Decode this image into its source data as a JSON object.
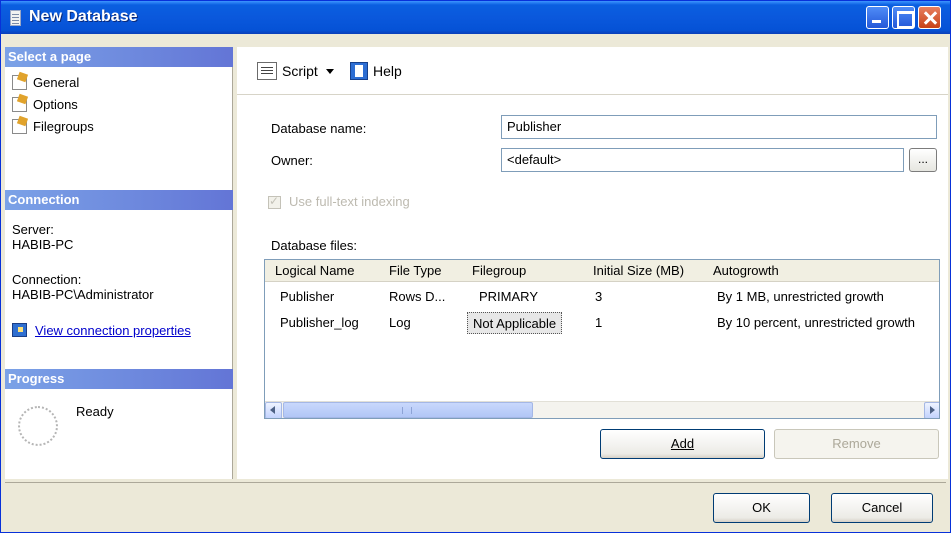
{
  "window": {
    "title": "New Database"
  },
  "left": {
    "select_page_header": "Select a page",
    "pages": [
      "General",
      "Options",
      "Filegroups"
    ],
    "connection_header": "Connection",
    "server_label": "Server:",
    "server_value": "HABIB-PC",
    "connection_label": "Connection:",
    "connection_value": "HABIB-PC\\Administrator",
    "view_connection_link": "View connection properties",
    "progress_header": "Progress",
    "progress_status": "Ready"
  },
  "toolbar": {
    "script_label": "Script",
    "help_label": "Help"
  },
  "form": {
    "db_name_label": "Database name:",
    "db_name_value": "Publisher",
    "owner_label": "Owner:",
    "owner_value": "<default>",
    "browse_label": "...",
    "fulltext_label": "Use full-text indexing"
  },
  "files": {
    "label": "Database files:",
    "columns": [
      "Logical Name",
      "File Type",
      "Filegroup",
      "Initial Size (MB)",
      "Autogrowth"
    ],
    "rows": [
      [
        "Publisher",
        "Rows D...",
        "PRIMARY",
        "3",
        "By 1 MB, unrestricted growth"
      ],
      [
        "Publisher_log",
        "Log",
        "Not Applicable",
        "1",
        "By 10 percent, unrestricted growth"
      ]
    ],
    "scroll_fraction": 0.37,
    "add_label": "Add",
    "remove_label": "Remove"
  },
  "footer": {
    "ok_label": "OK",
    "cancel_label": "Cancel"
  }
}
